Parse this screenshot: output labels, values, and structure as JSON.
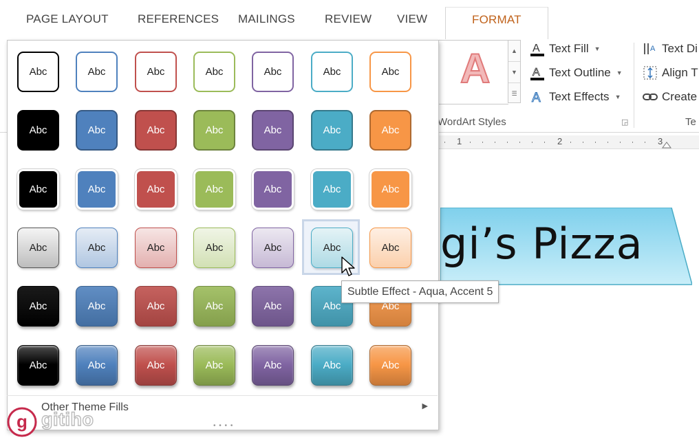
{
  "ribbon": {
    "tabs": [
      {
        "label": "PAGE LAYOUT"
      },
      {
        "label": "REFERENCES"
      },
      {
        "label": "MAILINGS"
      },
      {
        "label": "REVIEW"
      },
      {
        "label": "VIEW"
      },
      {
        "label": "FORMAT",
        "active": true
      }
    ],
    "wordart_group": {
      "preview_letter": "A",
      "label": "WordArt Styles",
      "commands": [
        {
          "label": "Text Fill",
          "icon": "text-fill-icon"
        },
        {
          "label": "Text Outline",
          "icon": "text-outline-icon"
        },
        {
          "label": "Text Effects",
          "icon": "text-effects-icon"
        }
      ]
    },
    "text_group": {
      "label": "Te",
      "commands": [
        {
          "label": "Text Di",
          "icon": "text-direction-icon"
        },
        {
          "label": "Align T",
          "icon": "align-text-icon"
        },
        {
          "label": "Create",
          "icon": "link-icon"
        }
      ]
    }
  },
  "ruler": {
    "numbers": [
      "1",
      "2",
      "3"
    ]
  },
  "document": {
    "wordart_text": "gi’s Pizza",
    "banner_color": "#a6e0f2"
  },
  "gallery": {
    "label_text": "Abc",
    "accent_colors": [
      "#000000",
      "#4f81bd",
      "#c0504d",
      "#9bbb59",
      "#8064a2",
      "#4bacc6",
      "#f79646"
    ],
    "row_styles": [
      "outline",
      "solid-fill",
      "solid-white-border",
      "subtle-gradient",
      "intense-effect",
      "glossy-bevel"
    ],
    "hovered": {
      "row": 4,
      "col": 6
    },
    "other_fills_label": "Other Theme Fills"
  },
  "tooltip": {
    "text": "Subtle Effect - Aqua, Accent 5"
  },
  "watermark": {
    "brand": "gitiho",
    "logo_letter": "g",
    "color": "#c62a4c"
  }
}
